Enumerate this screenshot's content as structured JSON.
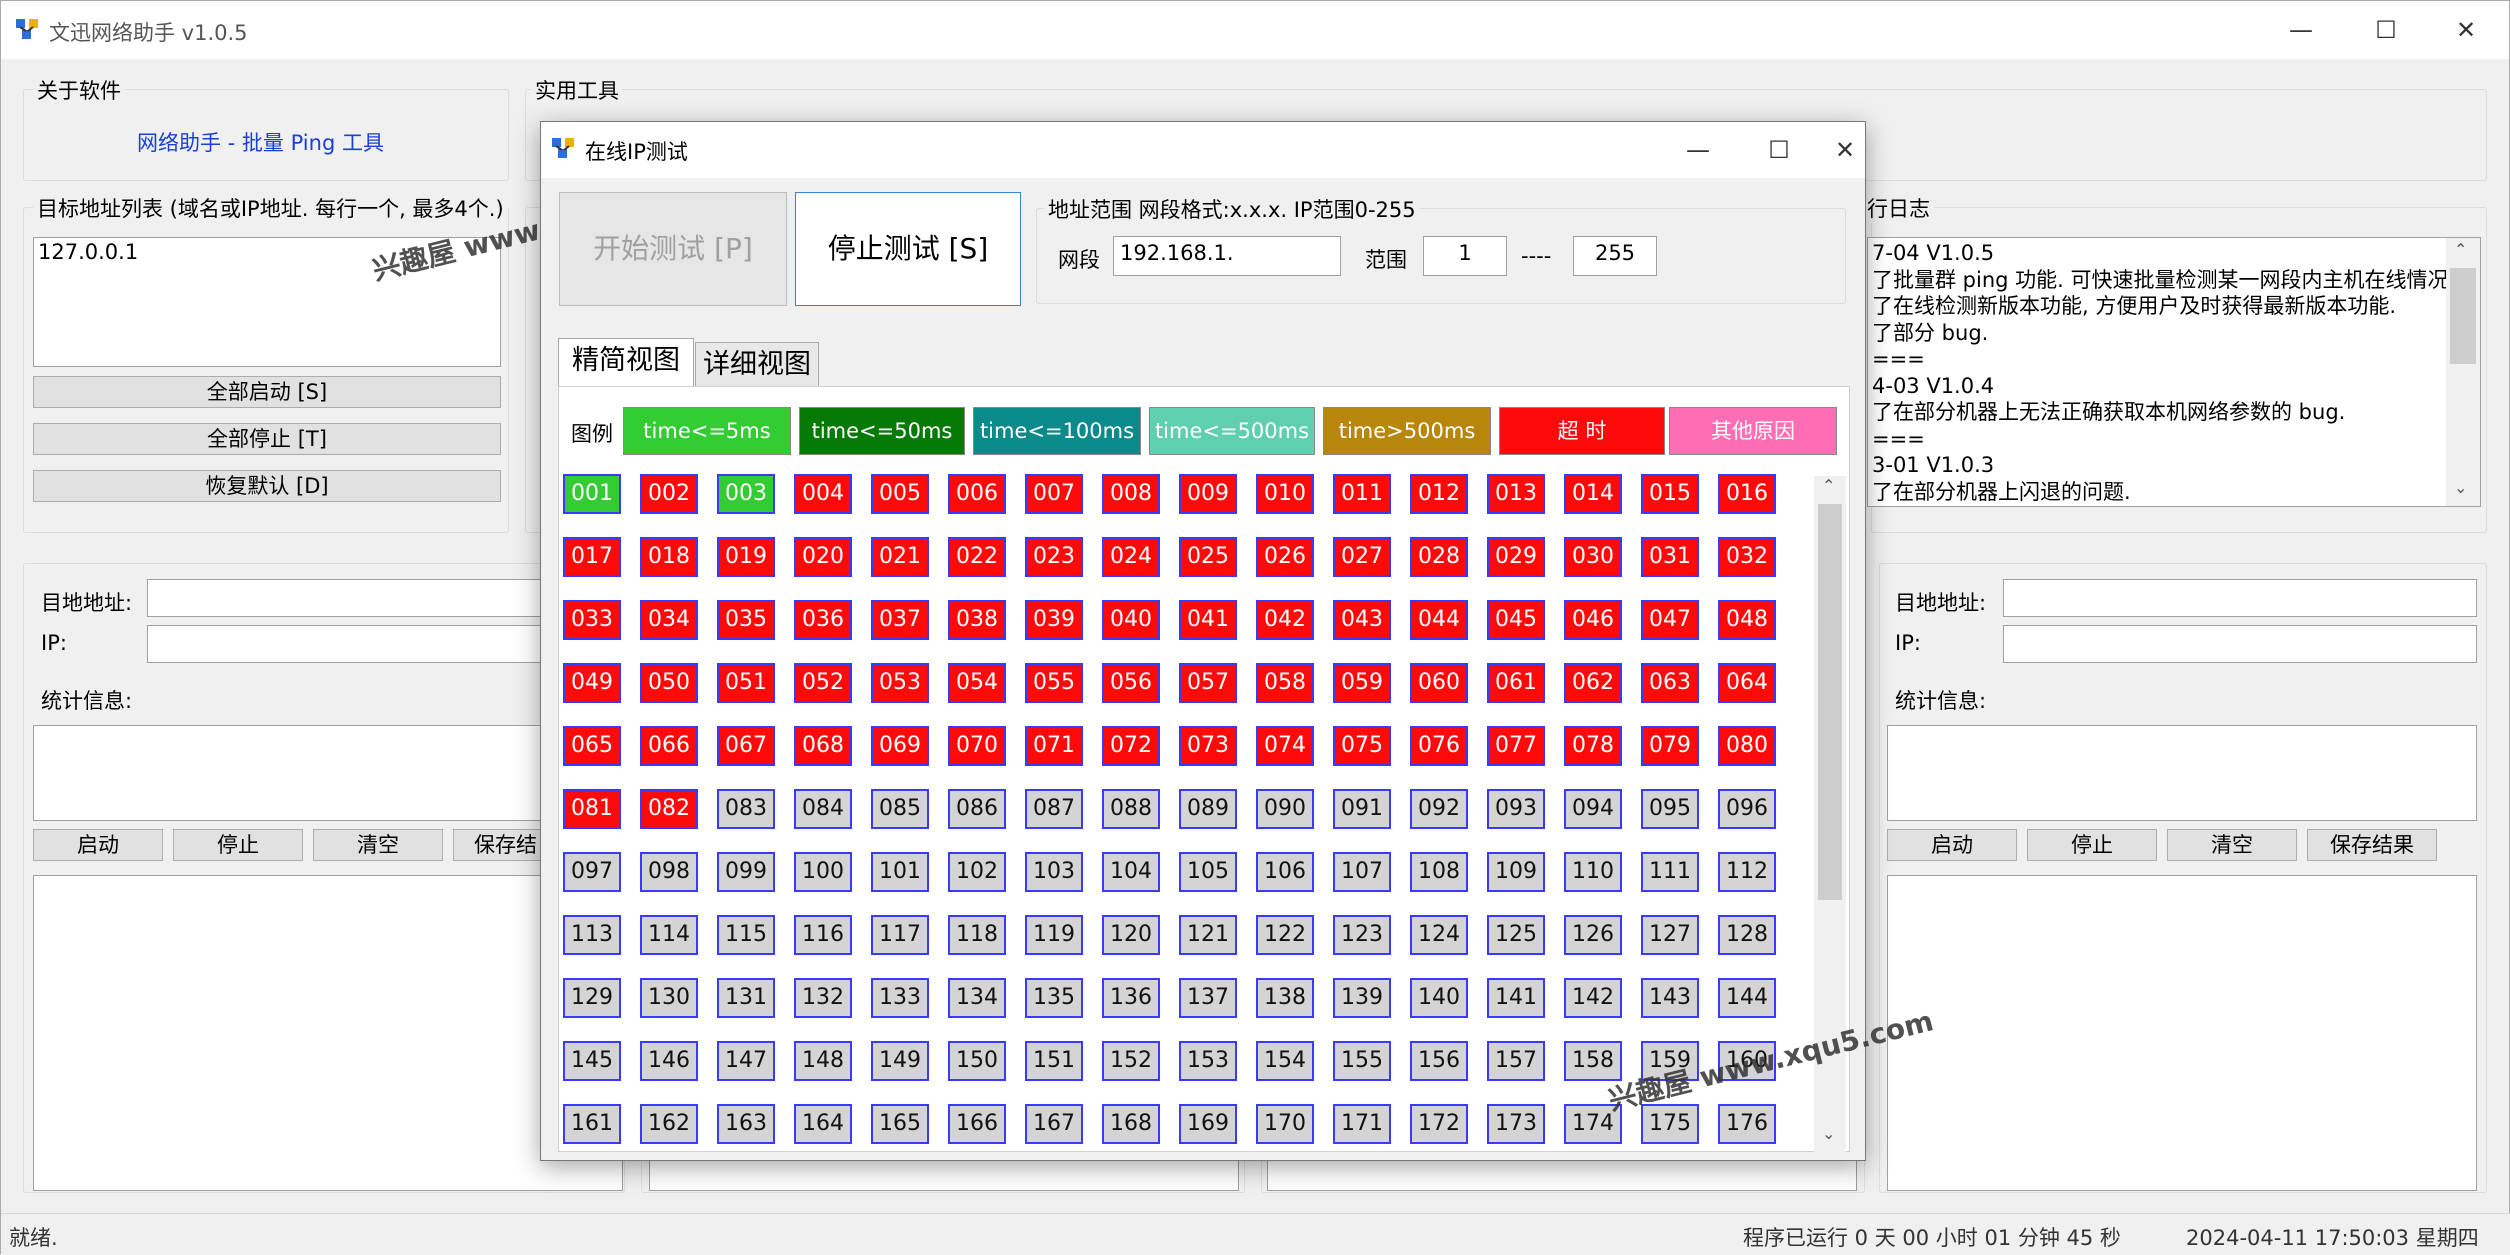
{
  "app": {
    "title": "文迅网络助手  v1.0.5"
  },
  "about": {
    "label": "关于软件",
    "link": "网络助手 - 批量 Ping 工具"
  },
  "tools": {
    "label": "实用工具"
  },
  "targets": {
    "label": "目标地址列表 (域名或IP地址. 每行一个, 最多4个.)",
    "value": "127.0.0.1",
    "start_all": "全部启动 [S]",
    "stop_all": "全部停止 [T]",
    "reset": "恢复默认 [D]"
  },
  "log": {
    "label": "行日志",
    "lines": [
      "7-04  V1.0.5",
      "了批量群 ping 功能. 可快速批量检测某一网段内主机在线情况.",
      "了在线检测新版本功能, 方便用户及时获得最新版本功能.",
      "了部分 bug.",
      "===",
      "4-03  V1.0.4",
      "了在部分机器上无法正确获取本机网络参数的 bug.",
      "===",
      "3-01  V1.0.3",
      "了在部分机器上闪退的问题."
    ]
  },
  "panel": {
    "target_label": "目地地址:",
    "ip_label": "IP:",
    "stats_label": "统计信息:",
    "start": "启动",
    "stop": "停止",
    "clear": "清空",
    "save": "保存结果",
    "save_trunc": "保存结"
  },
  "status": {
    "left": "就绪.",
    "runtime": "程序已运行 0 天 00 小时 01 分钟 45 秒",
    "datetime": "2024-04-11 17:50:03 星期四"
  },
  "dialog": {
    "title": "在线IP测试",
    "start_btn": "开始测试 [P]",
    "stop_btn": "停止测试 [S]",
    "range_label": "地址范围 网段格式:x.x.x.  IP范围0-255",
    "segment_label": "网段",
    "segment_value": "192.168.1.",
    "range_word": "范围",
    "range_from": "1",
    "range_sep": "----",
    "range_to": "255",
    "tabs": [
      "精简视图",
      "详细视图"
    ],
    "legend_label": "图例",
    "legend": [
      {
        "text": "time<=5ms",
        "color": "#33cc33",
        "fg": "#ffffff"
      },
      {
        "text": "time<=50ms",
        "color": "#067a06",
        "fg": "#ffffff"
      },
      {
        "text": "time<=100ms",
        "color": "#0a8a8a",
        "fg": "#ffffff"
      },
      {
        "text": "time<=500ms",
        "color": "#5fcfb0",
        "fg": "#ffffff"
      },
      {
        "text": "time>500ms",
        "color": "#b8860b",
        "fg": "#ffffff"
      },
      {
        "text": "超  时",
        "color": "#ff0a0a",
        "fg": "#ffffff"
      },
      {
        "text": "其他原因",
        "color": "#ff6eb4",
        "fg": "#ffffff"
      }
    ],
    "cell_colors": {
      "ok": "#33cc33",
      "timeout": "#ff0a0a",
      "pending": "#d4d4d4"
    },
    "ok_cells": [
      1,
      3
    ],
    "timeout_until": 82,
    "visible_count": 176
  },
  "watermark": "兴趣屋 www.xqu5.com"
}
